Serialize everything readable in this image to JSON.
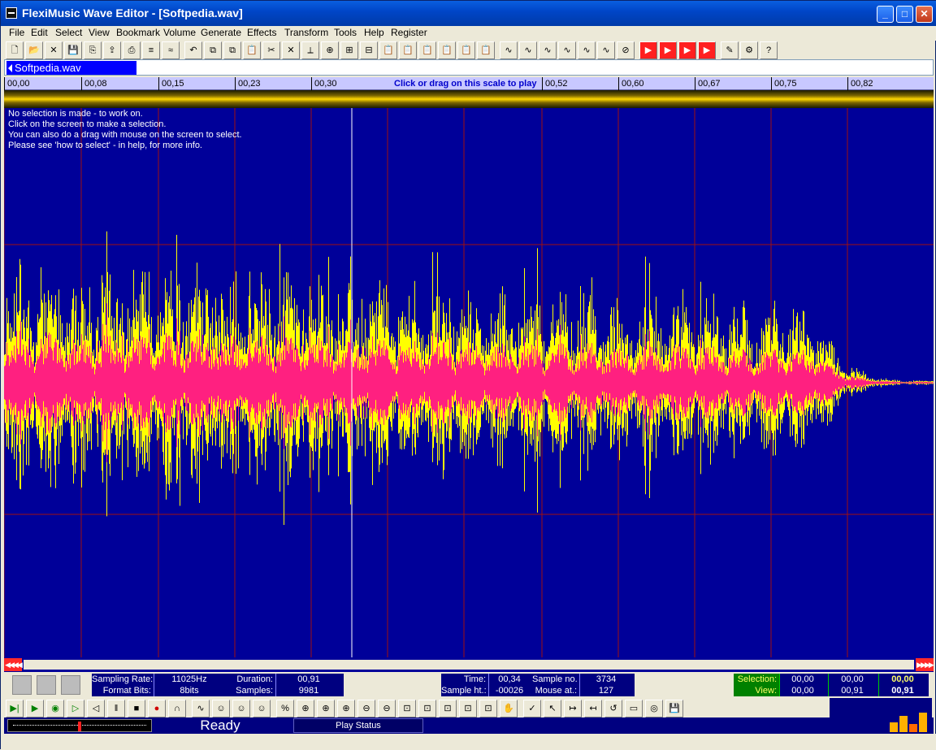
{
  "window": {
    "title": "FlexiMusic Wave Editor - [Softpedia.wav]"
  },
  "menu": [
    "File",
    "Edit",
    "Select",
    "View",
    "Bookmark",
    "Volume",
    "Generate",
    "Effects",
    "Transform",
    "Tools",
    "Help",
    "Register"
  ],
  "tab": {
    "label": "Softpedia.wav"
  },
  "ruler": {
    "ticks": [
      "00,00",
      "00,08",
      "00,15",
      "00,23",
      "00,30",
      "00,52",
      "00,60",
      "00,67",
      "00,75",
      "00,82"
    ],
    "hint": "Click or drag on this scale to play"
  },
  "info_text": "No selection is made - to work on.\nClick on the screen to make a selection.\nYou can also do a drag with mouse on the screen to select.\nPlease see 'how to select' - in help, for more info.",
  "stats": {
    "sampling_rate_label": "Sampling Rate:",
    "sampling_rate": "11025Hz",
    "format_bits_label": "Format Bits:",
    "format_bits": "8bits",
    "duration_label": "Duration:",
    "duration": "00,91",
    "samples_label": "Samples:",
    "samples": "9981",
    "time_label": "Time:",
    "time": "00,34",
    "sample_no_label": "Sample no.",
    "sample_no": "3734",
    "sample_ht_label": "Sample ht.:",
    "sample_ht": "-00026",
    "mouse_at_label": "Mouse at.:",
    "mouse_at": "127",
    "selection_label": "Selection:",
    "selection": [
      "00,00",
      "00,00",
      "00,00"
    ],
    "view_label": "View:",
    "view": [
      "00,00",
      "00,91",
      "00,91"
    ]
  },
  "status": {
    "ready": "Ready",
    "play_status": "Play Status"
  },
  "colors": {
    "wave_bg": "#000099",
    "wave_yellow": "#ffff00",
    "wave_pink": "#ff2080",
    "grid": "#a01010"
  }
}
